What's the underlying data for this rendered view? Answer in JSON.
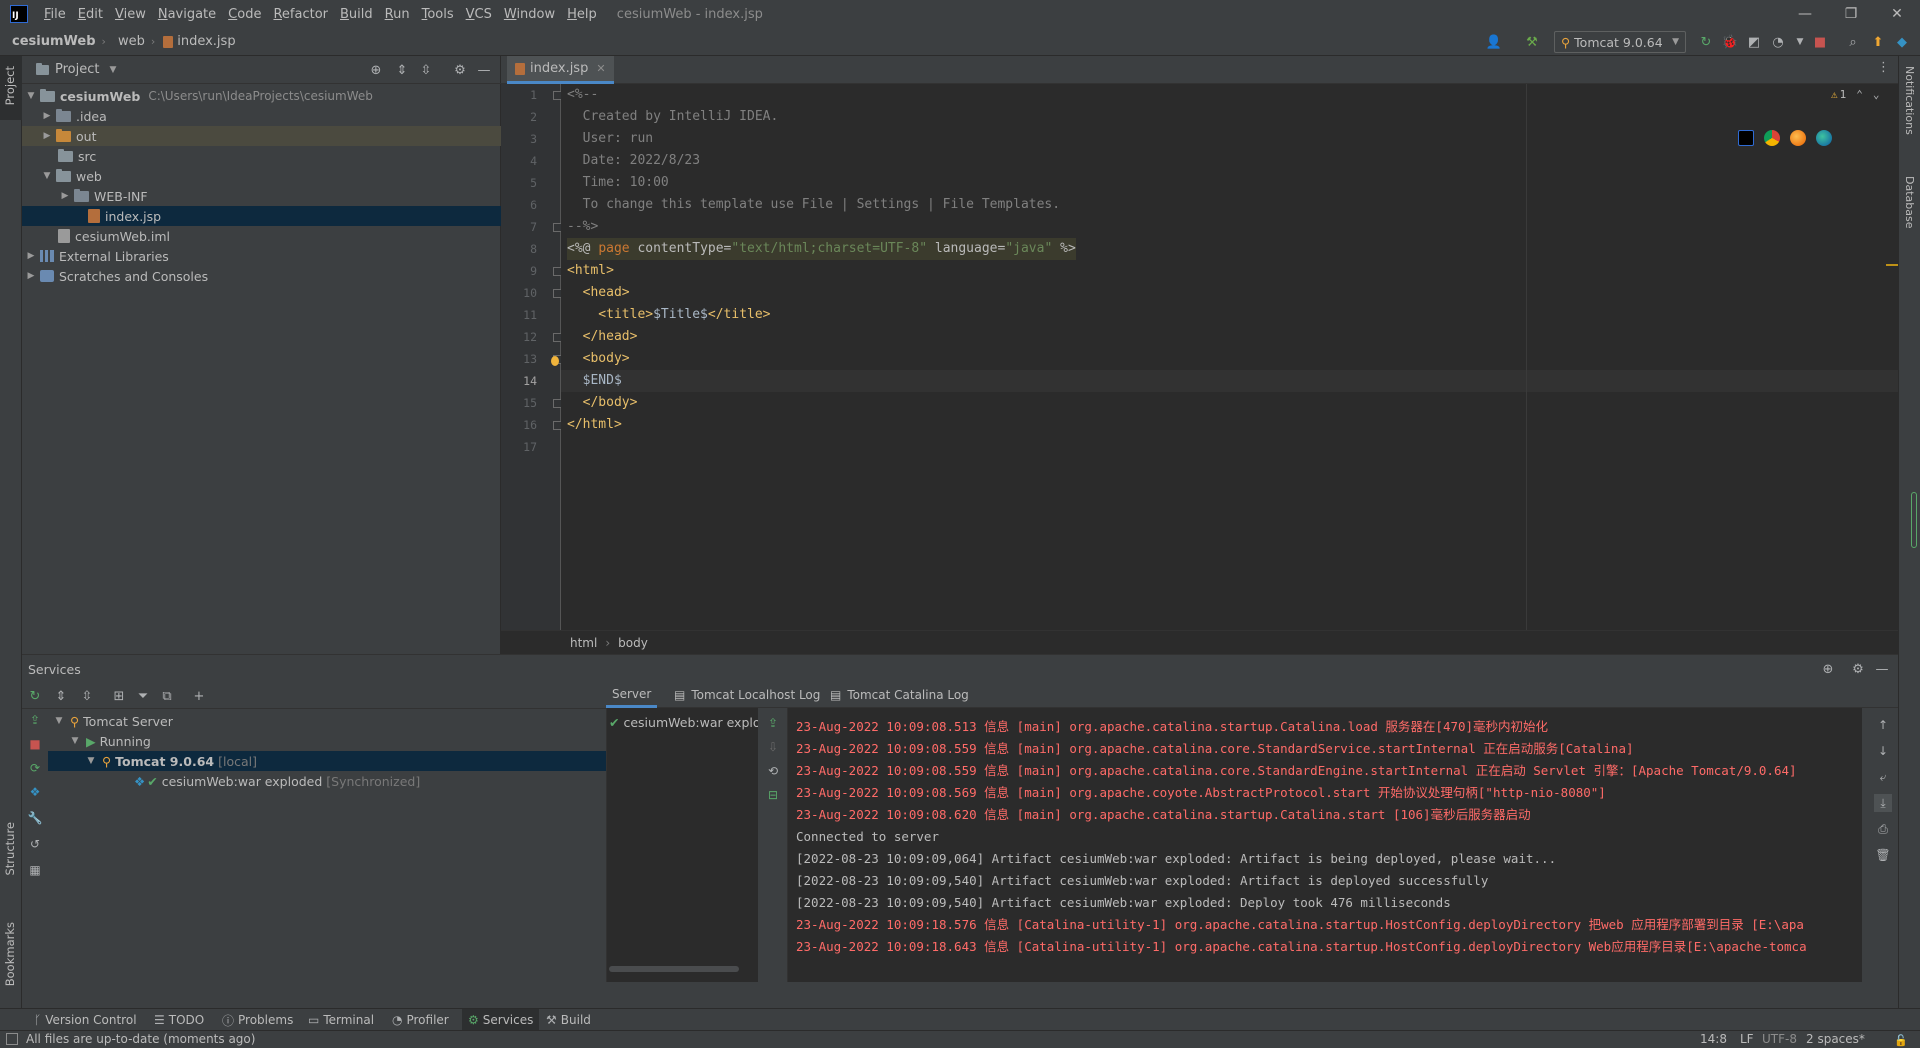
{
  "menu": {
    "logo": "IJ",
    "items": [
      "File",
      "Edit",
      "View",
      "Navigate",
      "Code",
      "Refactor",
      "Build",
      "Run",
      "Tools",
      "VCS",
      "Window",
      "Help"
    ],
    "window_title": "cesiumWeb - index.jsp"
  },
  "navbar": {
    "crumbs": [
      "cesiumWeb",
      "web",
      "index.jsp"
    ],
    "run_config": "Tomcat 9.0.64"
  },
  "left_strip": {
    "project": "Project",
    "structure": "Structure",
    "bookmarks": "Bookmarks"
  },
  "right_strip": {
    "notifications": "Notifications",
    "database": "Database"
  },
  "project": {
    "title": "Project",
    "tree": [
      {
        "label": "cesiumWeb",
        "hint": "C:\\Users\\run\\IdeaProjects\\cesiumWeb"
      },
      {
        "label": ".idea"
      },
      {
        "label": "out"
      },
      {
        "label": "src"
      },
      {
        "label": "web"
      },
      {
        "label": "WEB-INF"
      },
      {
        "label": "index.jsp"
      },
      {
        "label": "cesiumWeb.iml"
      },
      {
        "label": "External Libraries"
      },
      {
        "label": "Scratches and Consoles"
      }
    ]
  },
  "editor": {
    "tab": "index.jsp",
    "line_numbers": [
      "1",
      "2",
      "3",
      "4",
      "5",
      "6",
      "7",
      "8",
      "9",
      "10",
      "11",
      "12",
      "13",
      "14",
      "15",
      "16",
      "17"
    ],
    "current_line": "14",
    "code": {
      "l1": "<%--",
      "l2": "  Created by IntelliJ IDEA.",
      "l3": "  User: run",
      "l4": "  Date: 2022/8/23",
      "l5": "  Time: 10:00",
      "l6": "  To change this template use File | Settings | File Templates.",
      "l7": "--%>",
      "l8_open": "<%@ ",
      "l8_page": "page",
      "l8_attr1": " contentType=",
      "l8_val1": "\"text/html;charset=UTF-8\"",
      "l8_attr2": " language=",
      "l8_val2": "\"java\"",
      "l8_close": " %>",
      "l9": "<html>",
      "l10": "  <head>",
      "l11_open": "    <title>",
      "l11_var": "$Title$",
      "l11_close": "</title>",
      "l12": "  </head>",
      "l13": "  <body>",
      "l14": "  $END$",
      "l15": "  </body>",
      "l16": "</html>"
    },
    "warning_count": "1",
    "breadcrumb": [
      "html",
      "body"
    ]
  },
  "services": {
    "title": "Services",
    "tree": [
      {
        "label": "Tomcat Server"
      },
      {
        "label": "Running"
      },
      {
        "label": "Tomcat 9.0.64",
        "muted": "[local]"
      },
      {
        "label": "cesiumWeb:war exploded",
        "muted": "[Synchronized]"
      }
    ],
    "deploy_item": "cesiumWeb:war exploded",
    "tabs": [
      "Server",
      "Tomcat Localhost Log",
      "Tomcat Catalina Log"
    ],
    "log": [
      {
        "text": "23-Aug-2022 10:09:08.513 信息 [main] org.apache.catalina.startup.Catalina.load 服务器在[470]毫秒内初始化",
        "kind": "red"
      },
      {
        "text": "23-Aug-2022 10:09:08.559 信息 [main] org.apache.catalina.core.StandardService.startInternal 正在启动服务[Catalina]",
        "kind": "red"
      },
      {
        "text": "23-Aug-2022 10:09:08.559 信息 [main] org.apache.catalina.core.StandardEngine.startInternal 正在启动 Servlet 引擎：[Apache Tomcat/9.0.64]",
        "kind": "red"
      },
      {
        "text": "23-Aug-2022 10:09:08.569 信息 [main] org.apache.coyote.AbstractProtocol.start 开始协议处理句柄[\"http-nio-8080\"]",
        "kind": "red"
      },
      {
        "text": "23-Aug-2022 10:09:08.620 信息 [main] org.apache.catalina.startup.Catalina.start [106]毫秒后服务器启动",
        "kind": "red"
      },
      {
        "text": "Connected to server",
        "kind": "white"
      },
      {
        "text": "[2022-08-23 10:09:09,064] Artifact cesiumWeb:war exploded: Artifact is being deployed, please wait...",
        "kind": "white"
      },
      {
        "text": "[2022-08-23 10:09:09,540] Artifact cesiumWeb:war exploded: Artifact is deployed successfully",
        "kind": "white"
      },
      {
        "text": "[2022-08-23 10:09:09,540] Artifact cesiumWeb:war exploded: Deploy took 476 milliseconds",
        "kind": "white"
      },
      {
        "text": "23-Aug-2022 10:09:18.576 信息 [Catalina-utility-1] org.apache.catalina.startup.HostConfig.deployDirectory 把web 应用程序部署到目录 [E:\\apa",
        "kind": "red"
      },
      {
        "text": "23-Aug-2022 10:09:18.643 信息 [Catalina-utility-1] org.apache.catalina.startup.HostConfig.deployDirectory Web应用程序目录[E:\\apache-tomca",
        "kind": "red"
      }
    ]
  },
  "bottom_bar": [
    "Version Control",
    "TODO",
    "Problems",
    "Terminal",
    "Profiler",
    "Services",
    "Build"
  ],
  "status": {
    "message": "All files are up-to-date (moments ago)",
    "position": "14:8",
    "line_sep": "LF",
    "encoding": "UTF-8",
    "extra": "2 spaces*"
  }
}
